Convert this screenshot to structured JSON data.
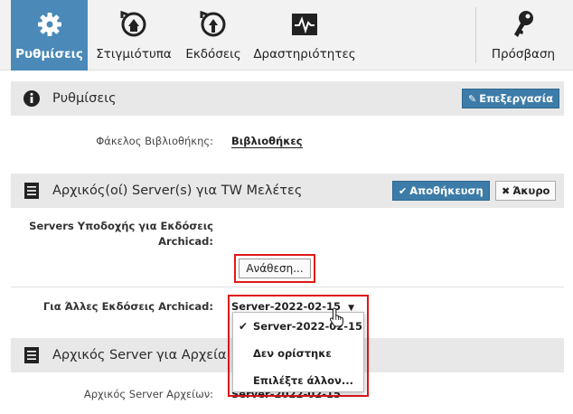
{
  "toolbar": {
    "items": [
      {
        "label": "Ρυθμίσεις",
        "icon": "gear-icon"
      },
      {
        "label": "Στιγμιότυπα",
        "icon": "snapshot-icon"
      },
      {
        "label": "Εκδόσεις",
        "icon": "versions-icon"
      },
      {
        "label": "Δραστηριότητες",
        "icon": "activity-icon"
      },
      {
        "label": "Πρόσβαση",
        "icon": "key-icon"
      }
    ]
  },
  "settings": {
    "title": "Ρυθμίσεις",
    "edit_label": "Επεξεργασία",
    "library_folder_label": "Φάκελος Βιβλιοθήκης:",
    "library_folder_value": "Βιβλιοθήκες"
  },
  "tw_servers": {
    "title": "Αρχικός(οί) Server(s) για TW Μελέτες",
    "save_label": "Αποθήκευση",
    "cancel_label": "Άκυρο",
    "hosting_label_line1": "Servers Υποδοχής για Εκδόσεις",
    "hosting_label_line2": "Archicad:",
    "assign_label": "Ανάθεση...",
    "other_versions_label": "Για Άλλες Εκδόσεις Archicad:",
    "selected_server": "Server-2022-02-15"
  },
  "dropdown": {
    "options": [
      {
        "label": "Server-2022-02-15",
        "checked": true
      },
      {
        "label": "Δεν ορίστηκε",
        "checked": false
      },
      {
        "label": "Επιλέξτε άλλον...",
        "checked": false
      }
    ]
  },
  "file_server": {
    "title": "Αρχικός Server για Αρχεία",
    "field_label": "Αρχικός Server Αρχείων:",
    "field_value": "Server-2022-02-15"
  },
  "colors": {
    "accent": "#4a89b8",
    "primary_button": "#3d7ca8",
    "highlight_border": "#e01818"
  }
}
